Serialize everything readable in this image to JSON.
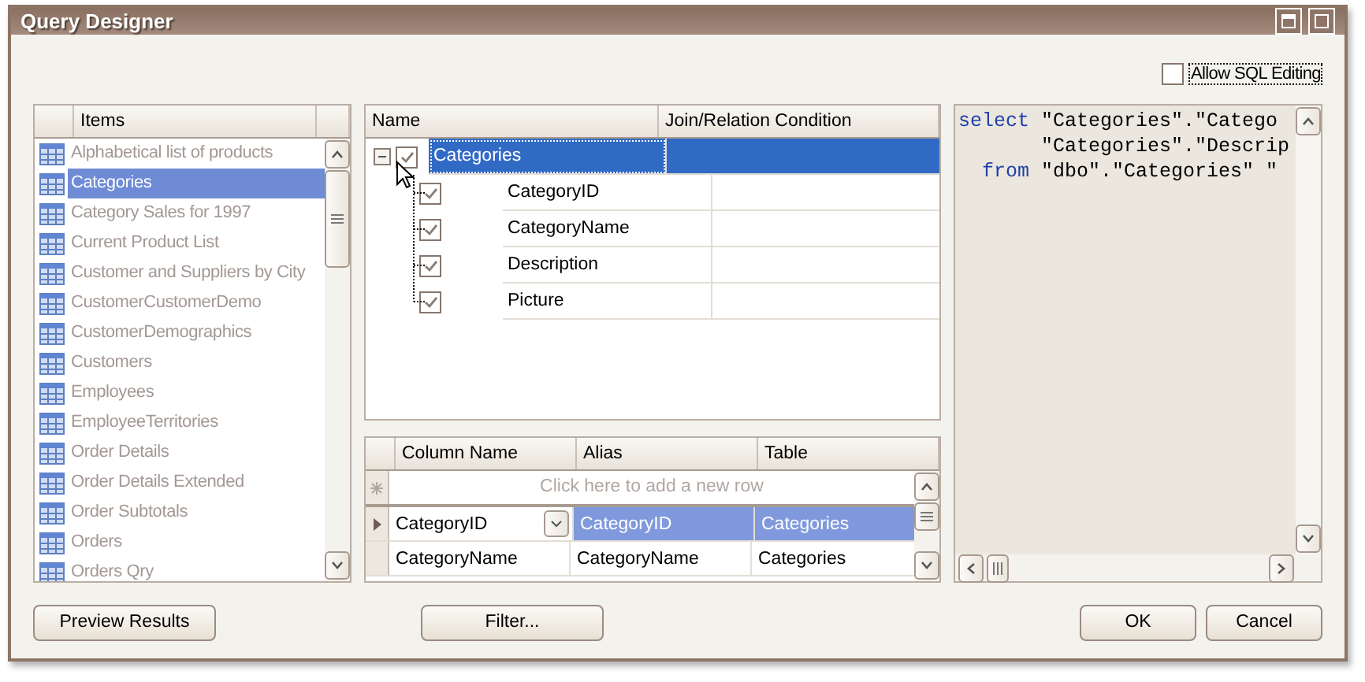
{
  "window": {
    "title": "Query Designer"
  },
  "allow_sql_editing": {
    "label": "Allow SQL Editing",
    "checked": false
  },
  "items_list": {
    "header": "Items",
    "items": [
      {
        "label": "Alphabetical list of products",
        "selected": false
      },
      {
        "label": "Categories",
        "selected": true
      },
      {
        "label": "Category Sales for 1997",
        "selected": false
      },
      {
        "label": "Current Product List",
        "selected": false
      },
      {
        "label": "Customer and Suppliers by City",
        "selected": false
      },
      {
        "label": "CustomerCustomerDemo",
        "selected": false
      },
      {
        "label": "CustomerDemographics",
        "selected": false
      },
      {
        "label": "Customers",
        "selected": false
      },
      {
        "label": "Employees",
        "selected": false
      },
      {
        "label": "EmployeeTerritories",
        "selected": false
      },
      {
        "label": "Order Details",
        "selected": false
      },
      {
        "label": "Order Details Extended",
        "selected": false
      },
      {
        "label": "Order Subtotals",
        "selected": false
      },
      {
        "label": "Orders",
        "selected": false
      },
      {
        "label": "Orders Qry",
        "selected": false
      }
    ]
  },
  "tree": {
    "columns": [
      "Name",
      "Join/Relation Condition"
    ],
    "root": {
      "label": "Categories",
      "checked": true,
      "expanded": true,
      "selected": true,
      "children": [
        {
          "label": "CategoryID",
          "checked": true
        },
        {
          "label": "CategoryName",
          "checked": true
        },
        {
          "label": "Description",
          "checked": true
        },
        {
          "label": "Picture",
          "checked": true
        }
      ]
    }
  },
  "grid": {
    "columns": [
      "Column Name",
      "Alias",
      "Table"
    ],
    "new_row_text": "Click here to add a new row",
    "rows": [
      {
        "cells": [
          "CategoryID",
          "CategoryID",
          "Categories"
        ],
        "selected": true
      },
      {
        "cells": [
          "CategoryName",
          "CategoryName",
          "Categories"
        ],
        "selected": false
      }
    ]
  },
  "sql": {
    "lines": [
      {
        "keyword": "select",
        "text": "\"Categories\".\"Catego"
      },
      {
        "text": "\"Categories\".\"Descrip"
      },
      {
        "keyword": "from",
        "text": "\"dbo\".\"Categories\" \""
      }
    ]
  },
  "buttons": {
    "left": [
      "Preview Results",
      "Filter..."
    ],
    "right": [
      "OK",
      "Cancel"
    ]
  }
}
